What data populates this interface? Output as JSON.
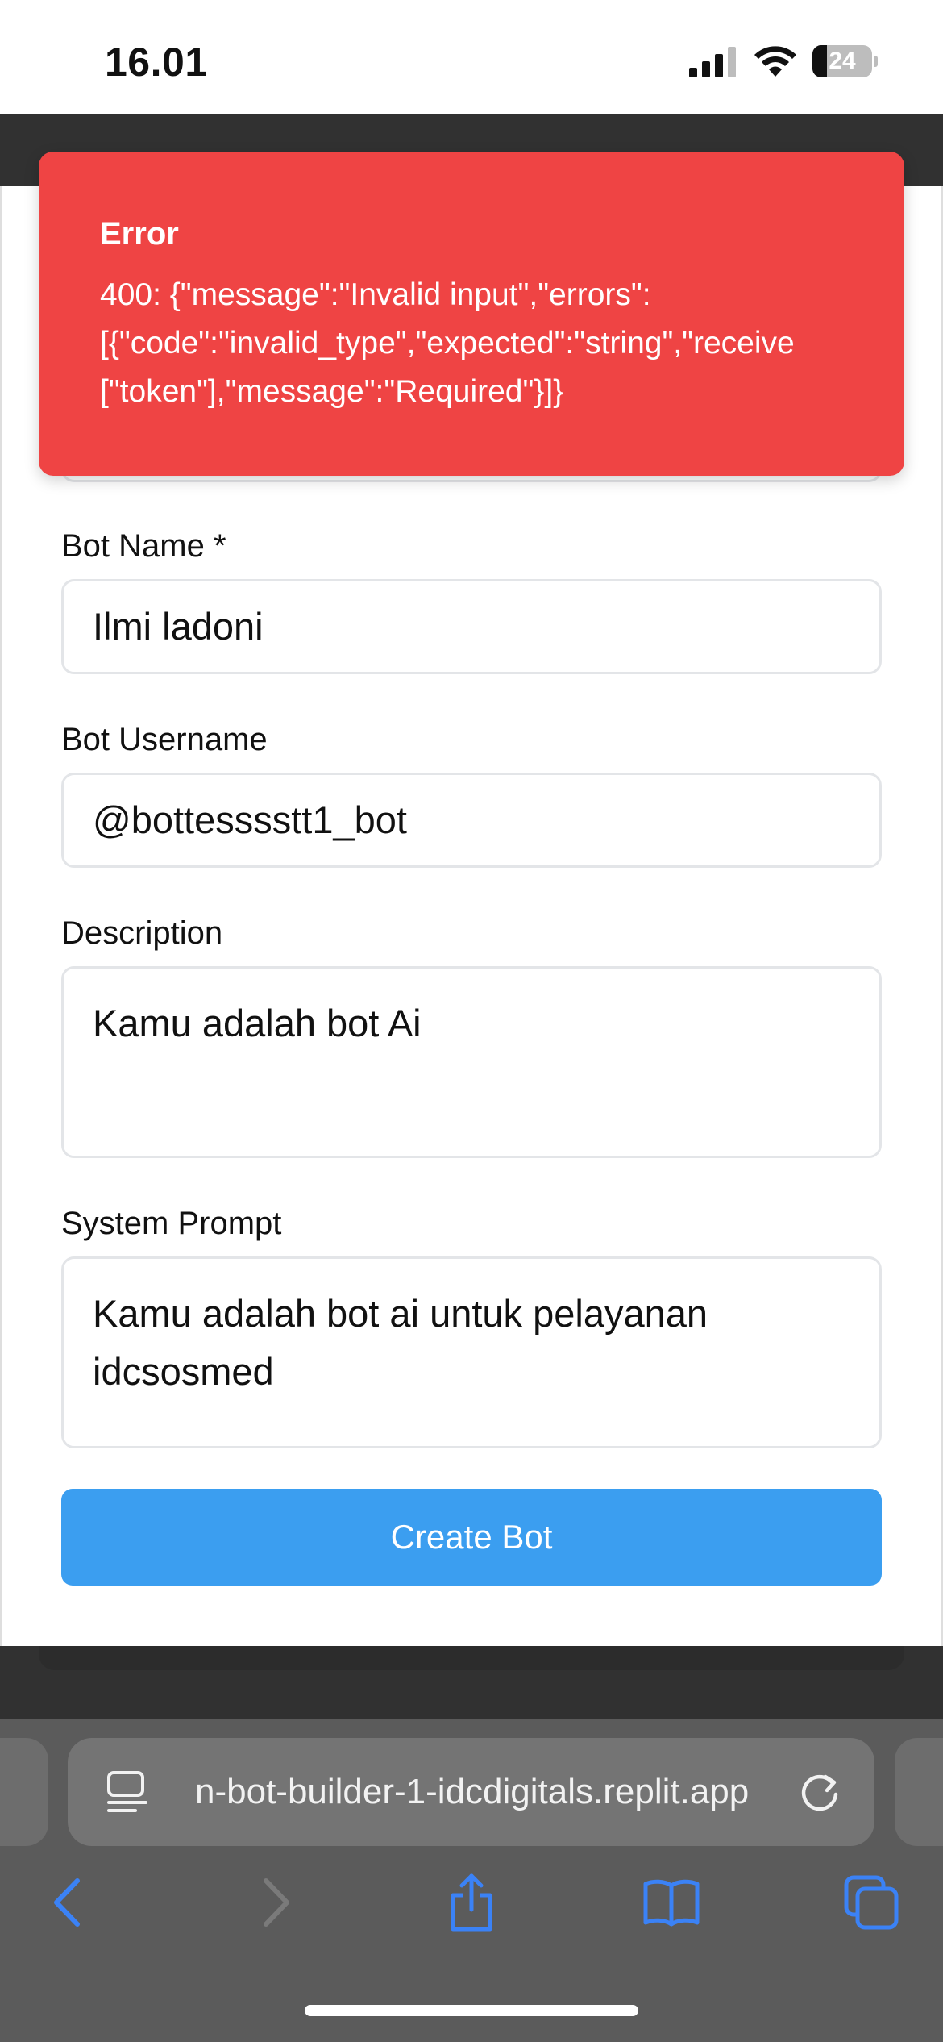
{
  "status_bar": {
    "time": "16.01",
    "battery": "24",
    "battery_level": 0.24
  },
  "toast": {
    "title": "Error",
    "message": "400: {\"message\":\"Invalid input\",\"errors\":\n[{\"code\":\"invalid_type\",\"expected\":\"string\",\"receive\n[\"token\"],\"message\":\"Required\"}]}"
  },
  "form": {
    "bot_name_label": "Bot Name *",
    "bot_name_value": "Ilmi ladoni",
    "bot_username_label": "Bot Username",
    "bot_username_value": "@bottesssstt1_bot",
    "description_label": "Description",
    "description_value": "Kamu adalah bot Ai",
    "system_prompt_label": "System Prompt",
    "system_prompt_value": "Kamu adalah bot ai untuk pelayanan idcsosmed",
    "create_button": "Create Bot"
  },
  "browser": {
    "url": "n-bot-builder-1-idcdigitals.replit.app"
  },
  "colors": {
    "toast_bg": "#ef4444",
    "primary": "#3b9ef0",
    "browser_accent": "#3b82f6"
  },
  "icons": [
    "signal-icon",
    "wifi-icon",
    "battery-icon",
    "reader-icon",
    "reload-icon",
    "back-icon",
    "forward-icon",
    "share-icon",
    "bookmarks-icon",
    "tabs-icon"
  ]
}
